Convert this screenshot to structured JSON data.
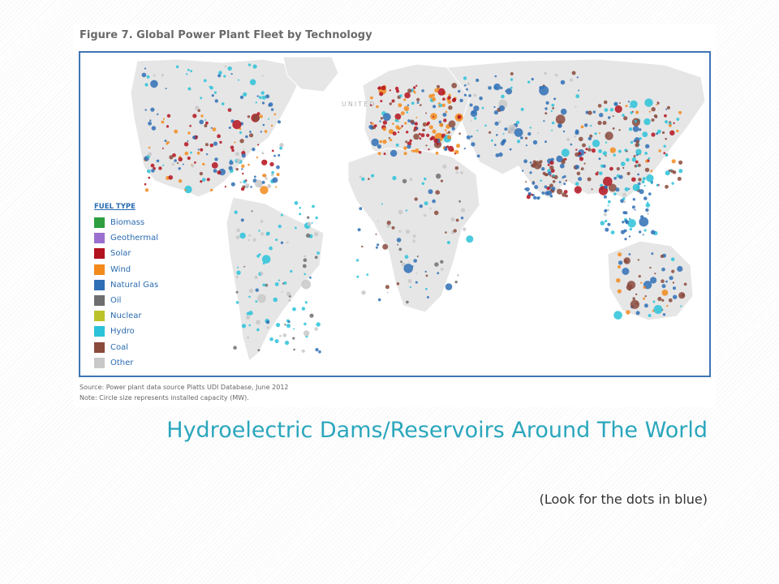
{
  "figure": {
    "title": "Figure 7. Global Power Plant Fleet by Technology",
    "map_label": "UNITED",
    "legend": {
      "title": "FUEL TYPE",
      "items": [
        {
          "label": "Biomass",
          "color": "#2e9e3e"
        },
        {
          "label": "Geothermal",
          "color": "#9a6fcf"
        },
        {
          "label": "Solar",
          "color": "#b3121f"
        },
        {
          "label": "Wind",
          "color": "#f28a1c"
        },
        {
          "label": "Natural Gas",
          "color": "#2f6fb5"
        },
        {
          "label": "Oil",
          "color": "#6e6e6e"
        },
        {
          "label": "Nuclear",
          "color": "#bcc32a"
        },
        {
          "label": "Hydro",
          "color": "#2cc2d8"
        },
        {
          "label": "Coal",
          "color": "#8a4a3c"
        },
        {
          "label": "Other",
          "color": "#c8c8c8"
        }
      ]
    },
    "source": "Source: Power plant data source Platts UDI Database, June 2012",
    "note": "Note: Circle size represents installed capacity (MW)."
  },
  "slide": {
    "title": "Hydroelectric Dams/Reservoirs Around The World",
    "subtitle": "(Look for the dots in blue)"
  },
  "colors": {
    "frame": "#3f74b4",
    "land": "#e6e6e6",
    "title": "#2aa6bd",
    "legend_text": "#2a6bb0"
  }
}
